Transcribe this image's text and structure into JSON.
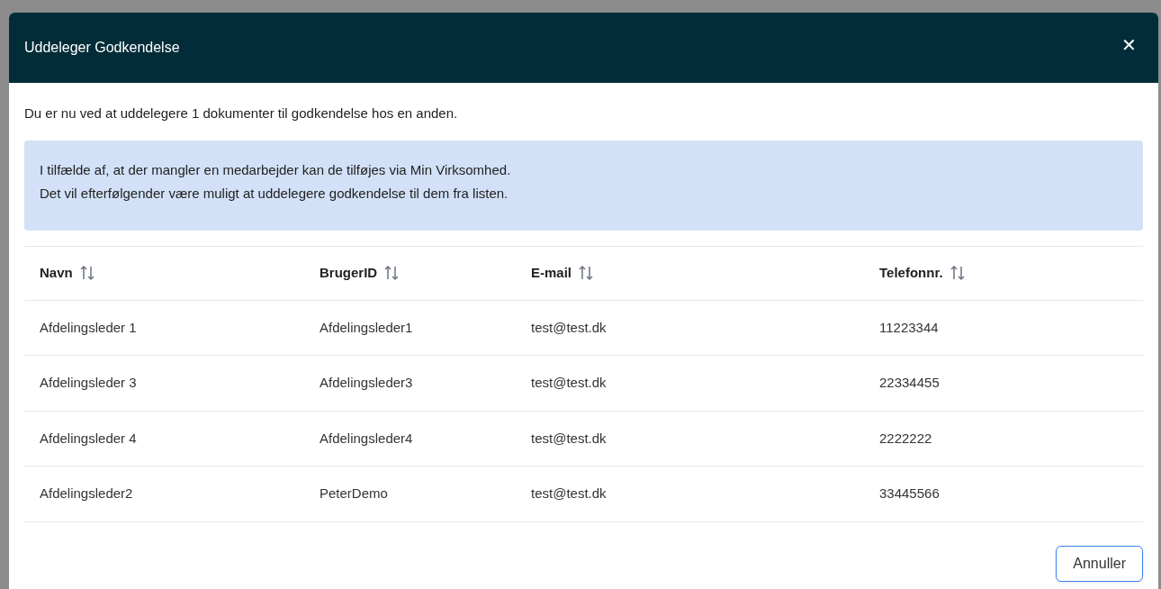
{
  "dialog": {
    "title": "Uddeleger Godkendelse",
    "close": "✕",
    "intro": "Du er nu ved at uddelegere 1 dokumenter til godkendelse hos en anden.",
    "info_lines": [
      "I tilfælde af, at der mangler en medarbejder kan de tilføjes via Min Virksomhed.",
      "Det vil efterfølgender være muligt at uddelegere godkendelse til dem fra listen."
    ],
    "table": {
      "columns": [
        "Navn",
        "BrugerID",
        "E-mail",
        "Telefonnr."
      ],
      "rows": [
        [
          "Afdelingsleder 1",
          "Afdelingsleder1",
          "test@test.dk",
          "11223344"
        ],
        [
          "Afdelingsleder 3",
          "Afdelingsleder3",
          "test@test.dk",
          "22334455"
        ],
        [
          "Afdelingsleder 4",
          "Afdelingsleder4",
          "test@test.dk",
          "2222222"
        ],
        [
          "Afdelingsleder2",
          "PeterDemo",
          "test@test.dk",
          "33445566"
        ]
      ]
    },
    "buttons": [
      "Annuller"
    ]
  }
}
